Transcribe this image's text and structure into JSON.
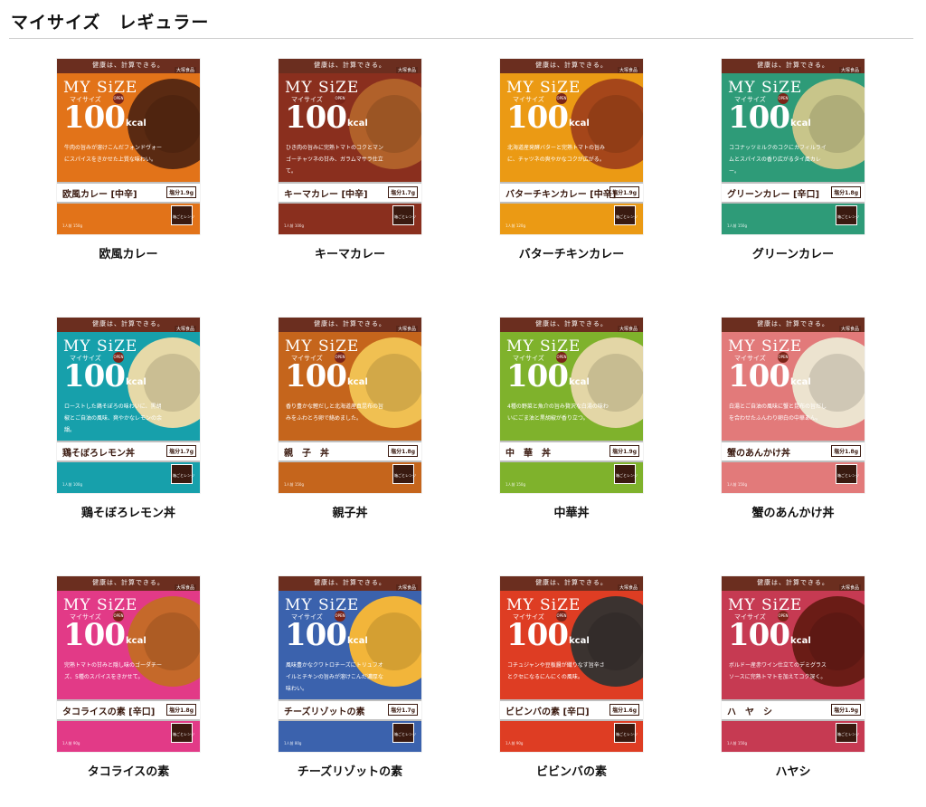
{
  "section": {
    "title": "マイサイズ　レギュラー"
  },
  "package": {
    "slogan": "健康は、計算できる。",
    "brand": "大塚食品",
    "logo": "MY SiZE",
    "logo_sub": "マイサイズ",
    "open": "OPEN",
    "kcal_num": "100",
    "kcal_unit": "kcal",
    "range_label": "箱ごとレンジ"
  },
  "products": [
    {
      "name": "欧風カレー",
      "pack_name": "欧風カレー [中辛]",
      "salt": "塩分1.9g",
      "desc": "牛肉の旨みが溶けこんだフォンドヴォーにスパイスをきかせた上質な味わい。",
      "weight": "1人前 150g",
      "color": "#e27319",
      "food": "#5a2a12"
    },
    {
      "name": "キーマカレー",
      "pack_name": "キーマカレー [中辛]",
      "salt": "塩分1.7g",
      "desc": "ひき肉の旨みに完熟トマトのコクとマンゴーチャツネの甘み、ガラムマサラ仕立て。",
      "weight": "1人前 100g",
      "color": "#8a2f1e",
      "food": "#b1612a"
    },
    {
      "name": "バターチキンカレー",
      "pack_name": "バターチキンカレー [中辛]",
      "salt": "塩分1.9g",
      "desc": "北海道産発酵バターと完熟トマトの旨みに、チャツネの爽やかなコクが広がる。",
      "weight": "1人前 120g",
      "color": "#eb9a14",
      "food": "#a5461a"
    },
    {
      "name": "グリーンカレー",
      "pack_name": "グリーンカレー [辛口]",
      "salt": "塩分1.8g",
      "desc": "ココナッツミルクのコクにカフィルライムとスパイスの香り広がるタイ風カレー。",
      "weight": "1人前 150g",
      "color": "#2e9b78",
      "food": "#c8c58a"
    },
    {
      "name": "鶏そぼろレモン丼",
      "pack_name": "鶏そぼろレモン丼",
      "salt": "塩分1.7g",
      "desc": "ローストした鶏そぼろの味わいに、黒胡椒とご自油の風味、爽やかなレモンの余韻。",
      "weight": "1人前 100g",
      "color": "#17a0ab",
      "food": "#e6d9a8"
    },
    {
      "name": "親子丼",
      "pack_name": "親　子　丼",
      "salt": "塩分1.8g",
      "desc": "香り豊かな鰹だしと北海道産真昆布の旨みをふわとろ卵で絡めました。",
      "weight": "1人前 150g",
      "color": "#c5651c",
      "food": "#f0c052"
    },
    {
      "name": "中華丼",
      "pack_name": "中　華　丼",
      "salt": "塩分1.9g",
      "desc": "4種の野菜と魚介の旨み贅沢な白湯の味わいにごま油と黒胡椒が香り立つ。",
      "weight": "1人前 150g",
      "color": "#7fb22c",
      "food": "#e3d6a6"
    },
    {
      "name": "蟹のあんかけ丼",
      "pack_name": "蟹のあんかけ丼",
      "salt": "塩分1.8g",
      "desc": "白湯とご自油の風味に蟹と昆布の旨だしを合わせたふんわり卵白の中華あん。",
      "weight": "1人前 150g",
      "color": "#e27a7a",
      "food": "#ece3cf"
    },
    {
      "name": "タコライスの素",
      "pack_name": "タコライスの素 [辛口]",
      "salt": "塩分1.8g",
      "desc": "完熟トマトの甘みと隠し味のゴーダチーズ、5種のスパイスをきかせて。",
      "weight": "1人前 90g",
      "color": "#e23a87",
      "food": "#c5692a"
    },
    {
      "name": "チーズリゾットの素",
      "pack_name": "チーズリゾットの素",
      "salt": "塩分1.7g",
      "desc": "風味豊かなクワトロチーズにトリュフオイルとチキンの旨みが溶けこんだ濃厚な味わい。",
      "weight": "1人前 80g",
      "color": "#3b62ad",
      "food": "#f2b53a"
    },
    {
      "name": "ビビンバの素",
      "pack_name": "ビビンバの素 [辛口]",
      "salt": "塩分1.6g",
      "desc": "コチュジャンや豆板醤が織りなす旨辛さとクセになるにんにくの風味。",
      "weight": "1人前 90g",
      "color": "#de3d23",
      "food": "#3b3330"
    },
    {
      "name": "ハヤシ",
      "pack_name": "ハ　ヤ　シ",
      "salt": "塩分1.9g",
      "desc": "ボルドー産赤ワイン仕立てのデミグラスソースに完熟トマトを加えてコク深く。",
      "weight": "1人前 150g",
      "color": "#c63a52",
      "food": "#6a1c16"
    }
  ]
}
